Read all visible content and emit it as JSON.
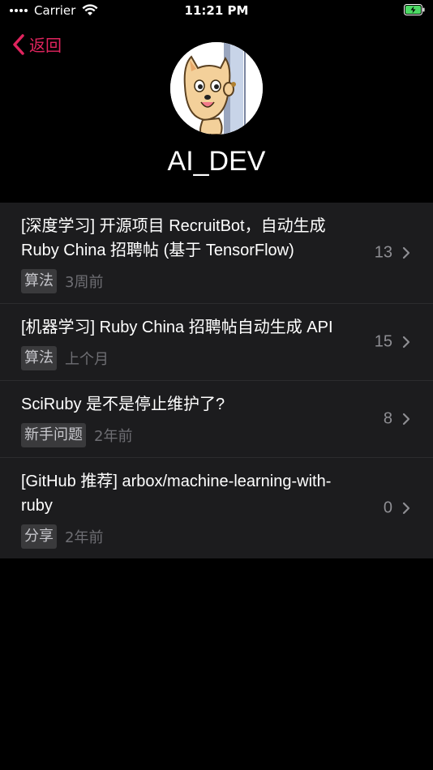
{
  "status_bar": {
    "carrier": "Carrier",
    "time": "11:21 PM"
  },
  "nav": {
    "back_label": "返回"
  },
  "profile": {
    "username": "AI_DEV"
  },
  "topics": [
    {
      "title": "[深度学习] 开源项目 RecruitBot，自动生成 Ruby China 招聘帖 (基于 TensorFlow)",
      "tag": "算法",
      "time": "3周前",
      "count": "13"
    },
    {
      "title": "[机器学习] Ruby China 招聘帖自动生成 API",
      "tag": "算法",
      "time": "上个月",
      "count": "15"
    },
    {
      "title": "SciRuby 是不是停止维护了?",
      "tag": "新手问题",
      "time": "2年前",
      "count": "8"
    },
    {
      "title": "[GitHub 推荐] arbox/machine-learning-with-ruby",
      "tag": "分享",
      "time": "2年前",
      "count": "0"
    }
  ],
  "colors": {
    "accent": "#e0245e",
    "background": "#000000",
    "list_bg": "#1c1c1e",
    "battery": "#4cd964"
  }
}
